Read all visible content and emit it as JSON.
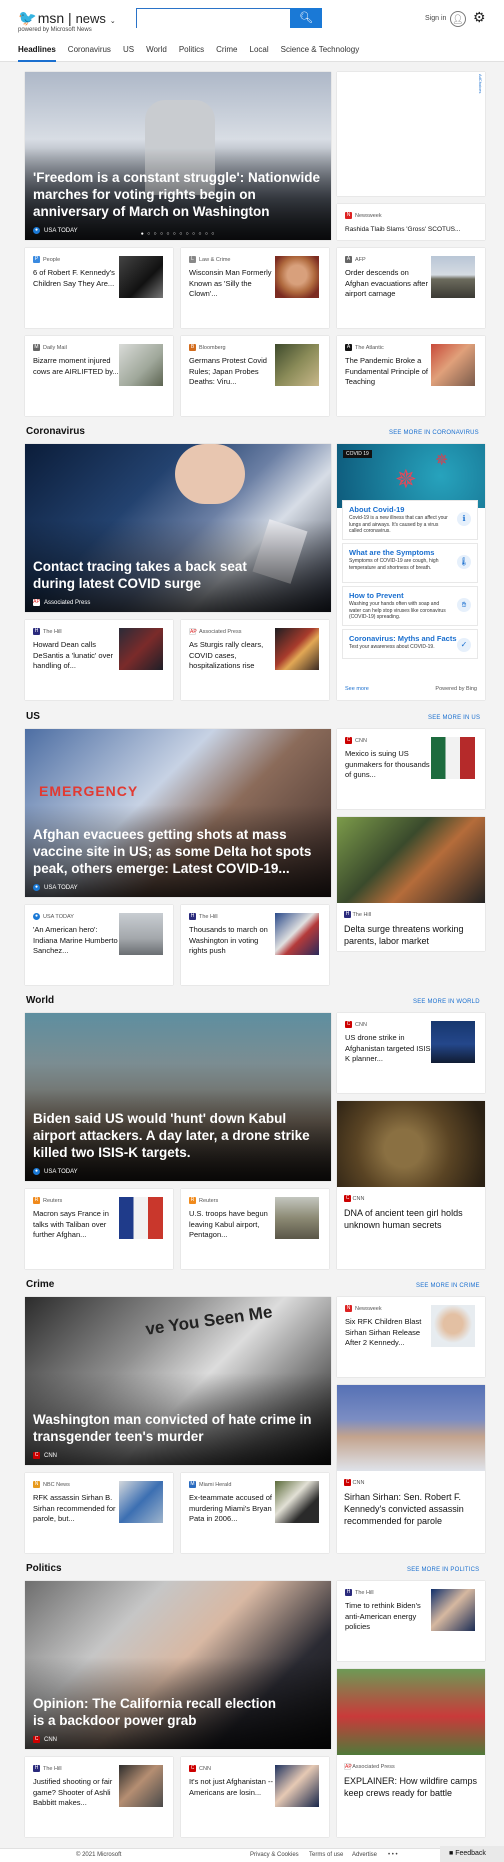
{
  "header": {
    "logo_msn": "msn",
    "logo_news": "news",
    "powered_by": "powered by Microsoft News",
    "search_placeholder": "",
    "search_icon": "search-icon",
    "sign_in": "Sign in",
    "settings_icon": "gear-icon"
  },
  "nav": [
    "Headlines",
    "Coronavirus",
    "US",
    "World",
    "Politics",
    "Crime",
    "Local",
    "Science & Technology"
  ],
  "ad_choices": "AdChoices",
  "headlines": {
    "hero": {
      "title": "'Freedom is a constant struggle': Nationwide marches for voting rights begin on anniversary of March on Washington",
      "source": "USA TODAY"
    },
    "side_card": {
      "source": "Newsweek",
      "title": "Rashida Tlaib Slams 'Gross' SCOTUS..."
    },
    "row1": [
      {
        "source": "People",
        "title": "6 of Robert F. Kennedy's Children Say They Are..."
      },
      {
        "source": "Law & Crime",
        "title": "Wisconsin Man Formerly Known as 'Silly the Clown'..."
      },
      {
        "source": "AFP",
        "title": "Order descends on Afghan evacuations after airport carnage"
      }
    ],
    "row2": [
      {
        "source": "Daily Mail",
        "title": "Bizarre moment injured cows are AIRLIFTED by..."
      },
      {
        "source": "Bloomberg",
        "title": "Germans Protest Covid Rules; Japan Probes Deaths: Viru..."
      },
      {
        "source": "The Atlantic",
        "title": "The Pandemic Broke a Fundamental Principle of Teaching"
      }
    ]
  },
  "coronavirus": {
    "heading": "Coronavirus",
    "more": "SEE MORE IN CORONAVIRUS",
    "hero": {
      "title": "Contact tracing takes a back seat during latest COVID surge",
      "source": "Associated Press"
    },
    "cards": [
      {
        "source": "The Hill",
        "title": "Howard Dean calls DeSantis a 'lunatic' over handling of..."
      },
      {
        "source": "Associated Press",
        "title": "As Sturgis rally clears, COVID cases, hospitalizations rise"
      }
    ],
    "widget": {
      "tag": "COVID 19",
      "items": [
        {
          "title": "About Covid-19",
          "text": "Covid-19 is a new illness that can affect your lungs and airways. It's caused by a virus called coronavirus."
        },
        {
          "title": "What are the Symptoms",
          "text": "Symptoms of COVID-19 are cough, high temperature and shortness of breath."
        },
        {
          "title": "How to Prevent",
          "text": "Washing your hands often with soap and water can help stop viruses like coronavirus (COVID-19) spreading."
        },
        {
          "title": "Coronavirus: Myths and Facts",
          "text": "Test your awareness about COVID-19."
        }
      ],
      "see_more": "See more",
      "powered": "Powered by Bing"
    }
  },
  "us": {
    "heading": "US",
    "more": "SEE MORE IN US",
    "hero": {
      "title": "Afghan evacuees getting shots at mass vaccine site in US; as some Delta hot spots peak, others emerge: Latest COVID-19...",
      "source": "USA TODAY",
      "sign_text": "EMERGENCY"
    },
    "side_small": {
      "source": "CNN",
      "title": "Mexico is suing US gunmakers for thousands of guns..."
    },
    "side_tall": {
      "source": "The Hill",
      "title": "Delta surge threatens working parents, labor market"
    },
    "cards": [
      {
        "source": "USA TODAY",
        "title": "'An American hero': Indiana Marine Humberto Sanchez..."
      },
      {
        "source": "The Hill",
        "title": "Thousands to march on Washington in voting rights push"
      }
    ]
  },
  "world": {
    "heading": "World",
    "more": "SEE MORE IN WORLD",
    "hero": {
      "title": "Biden said US would 'hunt' down Kabul airport attackers. A day later, a drone strike killed two ISIS-K targets.",
      "source": "USA TODAY"
    },
    "side_small": {
      "source": "CNN",
      "title": "US drone strike in Afghanistan targeted ISIS-K planner..."
    },
    "side_tall": {
      "source": "CNN",
      "title": "DNA of ancient teen girl holds unknown human secrets"
    },
    "cards": [
      {
        "source": "Reuters",
        "title": "Macron says France in talks with Taliban over further Afghan..."
      },
      {
        "source": "Reuters",
        "title": "U.S. troops have begun leaving Kabul airport, Pentagon..."
      }
    ]
  },
  "crime": {
    "heading": "Crime",
    "more": "SEE MORE IN CRIME",
    "hero": {
      "title": "Washington man convicted of hate crime in transgender teen's murder",
      "source": "CNN",
      "poster_text": "ve You Seen Me"
    },
    "side_small": {
      "source": "Newsweek",
      "title": "Six RFK Children Blast Sirhan Sirhan Release After 2 Kennedy..."
    },
    "side_tall": {
      "source": "CNN",
      "title": "Sirhan Sirhan: Sen. Robert F. Kennedy's convicted assassin recommended for parole"
    },
    "cards": [
      {
        "source": "NBC News",
        "title": "RFK assassin Sirhan B. Sirhan recommended for parole, but..."
      },
      {
        "source": "Miami Herald",
        "title": "Ex-teammate accused of murdering Miami's Bryan Pata in 2006..."
      }
    ]
  },
  "politics": {
    "heading": "Politics",
    "more": "SEE MORE IN POLITICS",
    "hero": {
      "title": "Opinion: The California recall election is a backdoor power grab",
      "source": "CNN"
    },
    "side_small": {
      "source": "The Hill",
      "title": "Time to rethink Biden's anti-American energy policies"
    },
    "side_tall": {
      "source": "Associated Press",
      "title": "EXPLAINER: How wildfire camps keep crews ready for battle"
    },
    "cards": [
      {
        "source": "The Hill",
        "title": "Justified shooting or fair game? Shooter of Ashli Babbitt makes..."
      },
      {
        "source": "CNN",
        "title": "It's not just Afghanistan -- Americans are losin..."
      }
    ]
  },
  "footer": {
    "copyright": "© 2021 Microsoft",
    "privacy": "Privacy & Cookies",
    "terms": "Terms of use",
    "advertise": "Advertise",
    "more": "• • •",
    "feedback": "Feedback"
  }
}
